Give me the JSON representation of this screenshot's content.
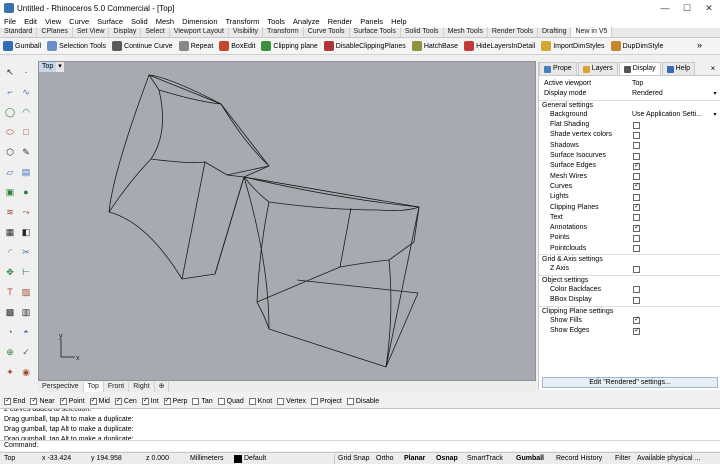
{
  "window": {
    "title": "Untitled - Rhinoceros 5.0 Commercial - [Top]",
    "controls": [
      "—",
      "☐",
      "✕"
    ]
  },
  "menu": [
    "File",
    "Edit",
    "View",
    "Curve",
    "Surface",
    "Solid",
    "Mesh",
    "Dimension",
    "Transform",
    "Tools",
    "Analyze",
    "Render",
    "Panels",
    "Help"
  ],
  "toolbar_tabs": [
    "Standard",
    "CPlanes",
    "Set View",
    "Display",
    "Select",
    "Viewport Layout",
    "Visibility",
    "Transform",
    "Curve Tools",
    "Surface Tools",
    "Solid Tools",
    "Mesh Tools",
    "Render Tools",
    "Drafting",
    "New in V5"
  ],
  "active_toolbar_tab": "New in V5",
  "command_toolbar": {
    "buttons": [
      {
        "label": "Gumball",
        "icon": "gumball-icon",
        "color": "#2f6db5"
      },
      {
        "label": "Selection Tools",
        "icon": "selection-tools-icon",
        "color": "#6a8fc7"
      },
      {
        "label": "Continue Curve",
        "icon": "continue-curve-icon",
        "color": "#5a5a5a"
      },
      {
        "label": "Repeat",
        "icon": "repeat-icon",
        "color": "#888888"
      },
      {
        "label": "BoxEdit",
        "icon": "boxedit-icon",
        "color": "#c04a2f"
      },
      {
        "label": "Clipping plane",
        "icon": "clipping-plane-icon",
        "color": "#3c8f3c"
      },
      {
        "label": "DisableClippingPlanes",
        "icon": "disable-clipping-icon",
        "color": "#b03535"
      },
      {
        "label": "HatchBase",
        "icon": "hatchbase-icon",
        "color": "#8f8f3c"
      },
      {
        "label": "HideLayersInDetail",
        "icon": "hide-layers-icon",
        "color": "#c23a3a"
      },
      {
        "label": "ImportDimStyles",
        "icon": "import-dimstyles-icon",
        "color": "#d2a72f"
      },
      {
        "label": "DupDimStyle",
        "icon": "dup-dimstyle-icon",
        "color": "#c4862f"
      }
    ],
    "more": "»"
  },
  "viewport": {
    "name": "Top",
    "dropdown": "▾",
    "axis_x": "x",
    "axis_y": "y",
    "tabs": [
      "Perspective",
      "Top",
      "Front",
      "Right",
      "⊕"
    ],
    "active_tab": "Top"
  },
  "osnap": [
    {
      "label": "End",
      "checked": true
    },
    {
      "label": "Near",
      "checked": true
    },
    {
      "label": "Point",
      "checked": true
    },
    {
      "label": "Mid",
      "checked": true
    },
    {
      "label": "Cen",
      "checked": true
    },
    {
      "label": "Int",
      "checked": true
    },
    {
      "label": "Perp",
      "checked": true
    },
    {
      "label": "Tan",
      "checked": false
    },
    {
      "label": "Quad",
      "checked": false
    },
    {
      "label": "Knot",
      "checked": false
    },
    {
      "label": "Vertex",
      "checked": false
    },
    {
      "label": "Project",
      "checked": false
    },
    {
      "label": "Disable",
      "checked": false
    }
  ],
  "command_history": [
    "2 curves added to selection.",
    "Drag gumball, tap Alt to make a duplicate:",
    "Drag gumball, tap Alt to make a duplicate:",
    "Drag gumball, tap Alt to make a duplicate:"
  ],
  "command_prompt": "Command:",
  "status": {
    "cplane": "Top",
    "x": "x -33.424",
    "y": "y 194.958",
    "z": "z 0.000",
    "units": "Millimeters",
    "layer": "Default",
    "layer_color": "#000000",
    "toggles": [
      "Grid Snap",
      "Ortho",
      "Planar",
      "Osnap",
      "SmartTrack",
      "Gumball",
      "Record History",
      "Filter"
    ],
    "bold_toggles": [
      "Planar",
      "Osnap",
      "Gumball"
    ],
    "memory": "Available physical ..."
  },
  "panel": {
    "tabs": [
      {
        "label": "Prope",
        "icon": "properties-icon",
        "color": "#4a7fc0"
      },
      {
        "label": "Layers",
        "icon": "layers-icon",
        "color": "#d9a233"
      },
      {
        "label": "Display",
        "icon": "display-icon",
        "color": "#555555"
      },
      {
        "label": "Help",
        "icon": "help-icon",
        "color": "#3a68b5"
      }
    ],
    "active_tab": "Display",
    "close": "×",
    "rows": [
      {
        "kind": "value",
        "label": "Active viewport",
        "value": "Top"
      },
      {
        "kind": "dropdown",
        "label": "Display mode",
        "value": "Rendered"
      },
      {
        "kind": "section",
        "label": "General settings"
      },
      {
        "kind": "dropdown",
        "label": "Background",
        "value": "Use Application Setti..."
      },
      {
        "kind": "check",
        "label": "Flat Shading",
        "checked": false
      },
      {
        "kind": "check",
        "label": "Shade vertex colors",
        "checked": false
      },
      {
        "kind": "check",
        "label": "Shadows",
        "checked": false
      },
      {
        "kind": "check",
        "label": "Surface Isocurves",
        "checked": false
      },
      {
        "kind": "check",
        "label": "Surface Edges",
        "checked": true
      },
      {
        "kind": "check",
        "label": "Mesh Wires",
        "checked": false
      },
      {
        "kind": "check",
        "label": "Curves",
        "checked": true
      },
      {
        "kind": "check",
        "label": "Lights",
        "checked": false
      },
      {
        "kind": "check",
        "label": "Clipping Planes",
        "checked": true
      },
      {
        "kind": "check",
        "label": "Text",
        "checked": false
      },
      {
        "kind": "check",
        "label": "Annotations",
        "checked": true
      },
      {
        "kind": "check",
        "label": "Points",
        "checked": false
      },
      {
        "kind": "check",
        "label": "Pointclouds",
        "checked": false
      },
      {
        "kind": "section",
        "label": "Grid & Axis settings"
      },
      {
        "kind": "check",
        "label": "Z Axis",
        "checked": false
      },
      {
        "kind": "section",
        "label": "Object settings"
      },
      {
        "kind": "check",
        "label": "Color Backfaces",
        "checked": false
      },
      {
        "kind": "check",
        "label": "BBox Display",
        "checked": false
      },
      {
        "kind": "section",
        "label": "Clipping Plane settings"
      },
      {
        "kind": "check",
        "label": "Show Fills",
        "checked": true
      },
      {
        "kind": "check",
        "label": "Show Edges",
        "checked": true
      }
    ],
    "edit_button": "Edit \"Rendered\" settings..."
  },
  "left_tools": [
    "select-arrow-icon",
    "point-icon",
    "polyline-icon",
    "curve-icon",
    "circle-icon",
    "arc-icon",
    "ellipse-icon",
    "rectangle-icon",
    "polygon-icon",
    "freeform-icon",
    "surface-icon",
    "extrude-icon",
    "box-solid-icon",
    "sphere-solid-icon",
    "loft-icon",
    "sweep-icon",
    "mesh-icon",
    "boolean-icon",
    "fillet-icon",
    "trim-icon",
    "move-icon",
    "dimension-icon",
    "text-icon",
    "hatch-icon",
    "group-icon",
    "layer-icon",
    "analyze-icon",
    "render-icon",
    "gumball-toggle-icon",
    "check-icon",
    "light-icon",
    "camera-icon"
  ],
  "left_tool_glyphs": [
    "↖",
    "·",
    "⌐",
    "∿",
    "◯",
    "◠",
    "⬭",
    "□",
    "⬡",
    "✎",
    "▱",
    "▤",
    "▣",
    "●",
    "≋",
    "⤳",
    "▦",
    "◧",
    "◜",
    "✂",
    "✥",
    "⊢",
    "T",
    "▨",
    "▩",
    "▥",
    "◔",
    "◓",
    "⊕",
    "✓",
    "✦",
    "◉"
  ]
}
